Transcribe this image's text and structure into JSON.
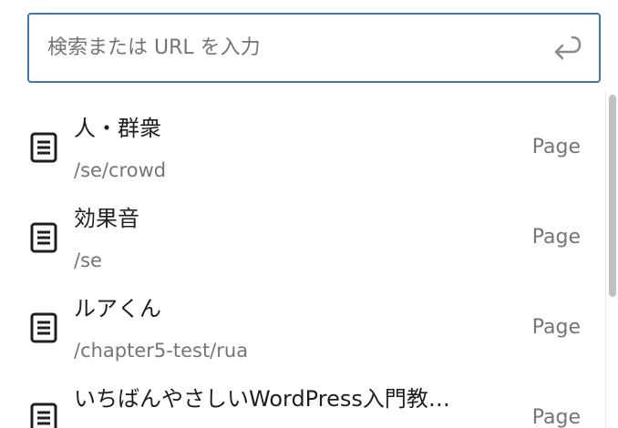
{
  "search": {
    "placeholder": "検索または URL を入力",
    "value": "",
    "submit_icon": "enter-return-icon"
  },
  "results": [
    {
      "title": "人・群衆",
      "url": "/se/crowd",
      "type": "Page",
      "icon": "page-icon"
    },
    {
      "title": "効果音",
      "url": "/se",
      "type": "Page",
      "icon": "page-icon"
    },
    {
      "title": "ルアくん",
      "url": "/chapter5-test/rua",
      "type": "Page",
      "icon": "page-icon"
    },
    {
      "title": "いちばんやさしいWordPress入門教…",
      "url": "",
      "type": "Page",
      "icon": "page-icon"
    }
  ],
  "colors": {
    "focus_border": "#3f78a8",
    "primary_text": "#1e1e1e",
    "secondary_text": "#757575"
  }
}
